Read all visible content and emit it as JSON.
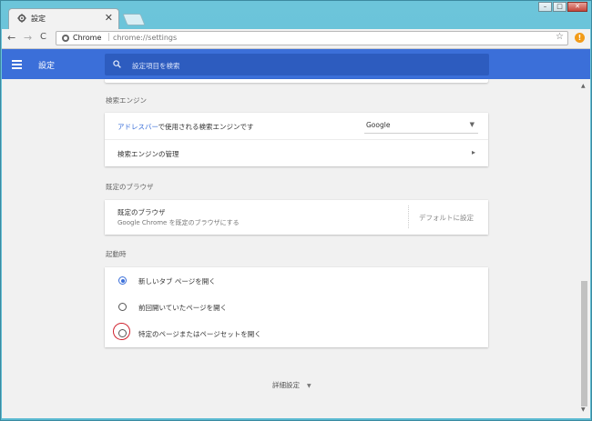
{
  "browser": {
    "tab_title": "設定",
    "tab_close": "✕",
    "back_glyph": "←",
    "forward_glyph": "→",
    "reload_glyph": "C",
    "omnibox_scheme": "Chrome",
    "omnibox_sep": "|",
    "omnibox_url": "chrome://settings",
    "star_glyph": "☆",
    "alert_glyph": "!",
    "win_min": "–",
    "win_max": "□",
    "win_close": "✕"
  },
  "header": {
    "title": "設定",
    "search_placeholder": "設定項目を検索"
  },
  "search_engine": {
    "section_title": "検索エンジン",
    "row1_link": "アドレスバー",
    "row1_rest": "で使用される検索エンジンです",
    "row1_value": "Google",
    "row1_arrow": "▼",
    "row2_label": "検索エンジンの管理",
    "row2_chevron": "▸"
  },
  "default_browser": {
    "section_title": "既定のブラウザ",
    "title": "既定のブラウザ",
    "subtitle": "Google Chrome を既定のブラウザにする",
    "button": "デフォルトに設定"
  },
  "startup": {
    "section_title": "起動時",
    "options": [
      {
        "label": "新しいタブ ページを開く",
        "selected": true
      },
      {
        "label": "前回開いていたページを開く",
        "selected": false
      },
      {
        "label": "特定のページまたはページセットを開く",
        "selected": false
      }
    ]
  },
  "advanced": {
    "label": "詳細設定",
    "arrow": "▼"
  },
  "colors": {
    "accent": "#3b6fd9",
    "header_search": "#2d5cbf",
    "highlight_circle": "#d0232f",
    "alert": "#f29b18"
  }
}
